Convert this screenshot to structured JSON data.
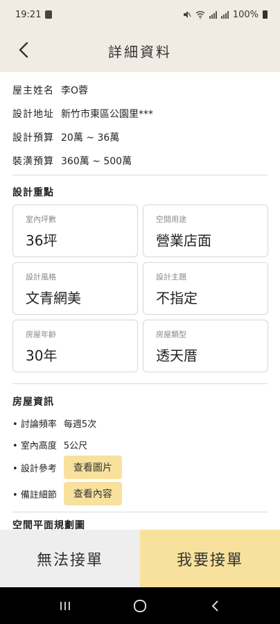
{
  "status": {
    "time": "19:21",
    "battery": "100%"
  },
  "header": {
    "title": "詳細資料"
  },
  "info": [
    {
      "label": "屋主姓名",
      "value": "李O蓉"
    },
    {
      "label": "設計地址",
      "value": "新竹市東區公園里***"
    },
    {
      "label": "設計預算",
      "value": "20萬 ~ 36萬"
    },
    {
      "label": "裝潢預算",
      "value": "360萬 ~ 500萬"
    }
  ],
  "focus": {
    "title": "設計重點",
    "cards": [
      {
        "key": "室內坪數",
        "value": "36坪"
      },
      {
        "key": "空間用途",
        "value": "營業店面"
      },
      {
        "key": "設計風格",
        "value": "文青網美"
      },
      {
        "key": "設計主題",
        "value": "不指定"
      },
      {
        "key": "房屋年齡",
        "value": "30年"
      },
      {
        "key": "房屋類型",
        "value": "透天厝"
      }
    ]
  },
  "house": {
    "title": "房屋資訊",
    "items": [
      {
        "label": "討論頻率",
        "value": "每週5次"
      },
      {
        "label": "室內高度",
        "value": "5公尺"
      },
      {
        "label": "設計參考",
        "button": "查看圖片"
      },
      {
        "label": "備註細節",
        "button": "查看內容"
      }
    ]
  },
  "next_section": {
    "title": "空間平面規劃圖"
  },
  "actions": {
    "reject": "無法接單",
    "accept": "我要接單"
  },
  "colors": {
    "header_bg": "#f1ebe4",
    "accent": "#f8e19d",
    "reject_bg": "#eeeeee"
  }
}
